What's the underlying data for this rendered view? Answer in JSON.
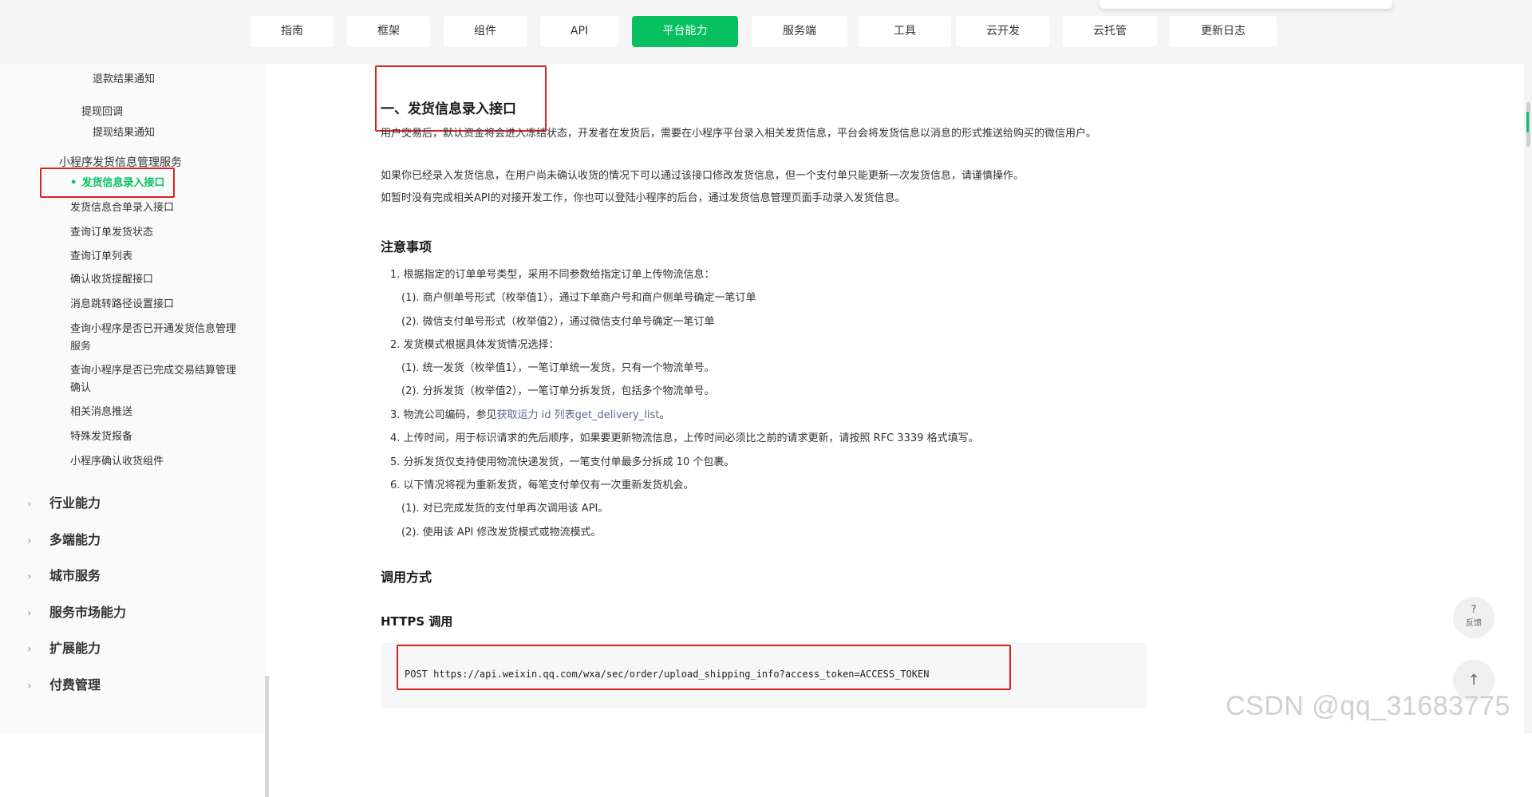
{
  "nav": {
    "tabs": [
      {
        "label": "指南",
        "active": false
      },
      {
        "label": "框架",
        "active": false
      },
      {
        "label": "组件",
        "active": false
      },
      {
        "label": "API",
        "active": false
      },
      {
        "label": "平台能力",
        "active": true
      },
      {
        "label": "服务端",
        "active": false
      },
      {
        "label": "工具",
        "active": false
      },
      {
        "label": "云开发",
        "active": false
      },
      {
        "label": "云托管",
        "active": false
      },
      {
        "label": "更新日志",
        "active": false
      }
    ],
    "accent_color": "#07c160"
  },
  "sidebar": {
    "items_top": [
      {
        "label": "退款结果通知"
      },
      {
        "label": "提现回调"
      },
      {
        "label": "提现结果通知"
      }
    ],
    "group_label": "小程序发货信息管理服务",
    "children": [
      {
        "label": "发货信息录入接口",
        "active": true
      },
      {
        "label": "发货信息合单录入接口"
      },
      {
        "label": "查询订单发货状态"
      },
      {
        "label": "查询订单列表"
      },
      {
        "label": "确认收货提醒接口"
      },
      {
        "label": "消息跳转路径设置接口"
      },
      {
        "label": "查询小程序是否已开通发货信息管理服务"
      },
      {
        "label": "查询小程序是否已完成交易结算管理确认"
      },
      {
        "label": "相关消息推送"
      },
      {
        "label": "特殊发货报备"
      },
      {
        "label": "小程序确认收货组件"
      }
    ],
    "categories": [
      {
        "label": "行业能力"
      },
      {
        "label": "多端能力"
      },
      {
        "label": "城市服务"
      },
      {
        "label": "服务市场能力"
      },
      {
        "label": "扩展能力"
      },
      {
        "label": "付费管理"
      }
    ]
  },
  "main": {
    "title": "一、发货信息录入接口",
    "paragraphs": [
      "用户交易后，默认资金将会进入冻结状态，开发者在发货后，需要在小程序平台录入相关发货信息，平台会将发货信息以消息的形式推送给购买的微信用户。",
      "如果你已经录入发货信息，在用户尚未确认收货的情况下可以通过该接口修改发货信息，但一个支付单只能更新一次发货信息，请谨慎操作。",
      "如暂时没有完成相关API的对接开发工作，你也可以登陆小程序的后台，通过发货信息管理页面手动录入发货信息。"
    ],
    "notes_heading": "注意事项",
    "notes": [
      {
        "text": "1. 根据指定的订单单号类型，采用不同参数给指定订单上传物流信息："
      },
      {
        "text": "(1). 商户侧单号形式（枚举值1），通过下单商户号和商户侧单号确定一笔订单"
      },
      {
        "text": "(2). 微信支付单号形式（枚举值2），通过微信支付单号确定一笔订单"
      },
      {
        "text": "2. 发货模式根据具体发货情况选择："
      },
      {
        "text": "(1). 统一发货（枚举值1），一笔订单统一发货，只有一个物流单号。"
      },
      {
        "text": "(2). 分拆发货（枚举值2），一笔订单分拆发货，包括多个物流单号。"
      },
      {
        "text_before": "3. 物流公司编码，参见",
        "link": "获取运力 id 列表get_delivery_list",
        "text_after": "。"
      },
      {
        "text": "4. 上传时间，用于标识请求的先后顺序，如果要更新物流信息，上传时间必须比之前的请求更新，请按照 RFC 3339 格式填写。"
      },
      {
        "text": "5. 分拆发货仅支持使用物流快递发货，一笔支付单最多分拆成 10 个包裹。"
      },
      {
        "text": "6. 以下情况将视为重新发货，每笔支付单仅有一次重新发货机会。"
      },
      {
        "text": "(1). 对已完成发货的支付单再次调用该 API。"
      },
      {
        "text": "(2). 使用该 API 修改发货模式或物流模式。"
      }
    ],
    "call_heading": "调用方式",
    "https_heading": "HTTPS 调用",
    "code": "POST https://api.weixin.qq.com/wxa/sec/order/upload_shipping_info?access_token=ACCESS_TOKEN"
  },
  "float_buttons": {
    "feedback_symbol": "?",
    "feedback_label": "反馈",
    "top_symbol": "↑"
  },
  "watermark": "CSDN @qq_31683775"
}
